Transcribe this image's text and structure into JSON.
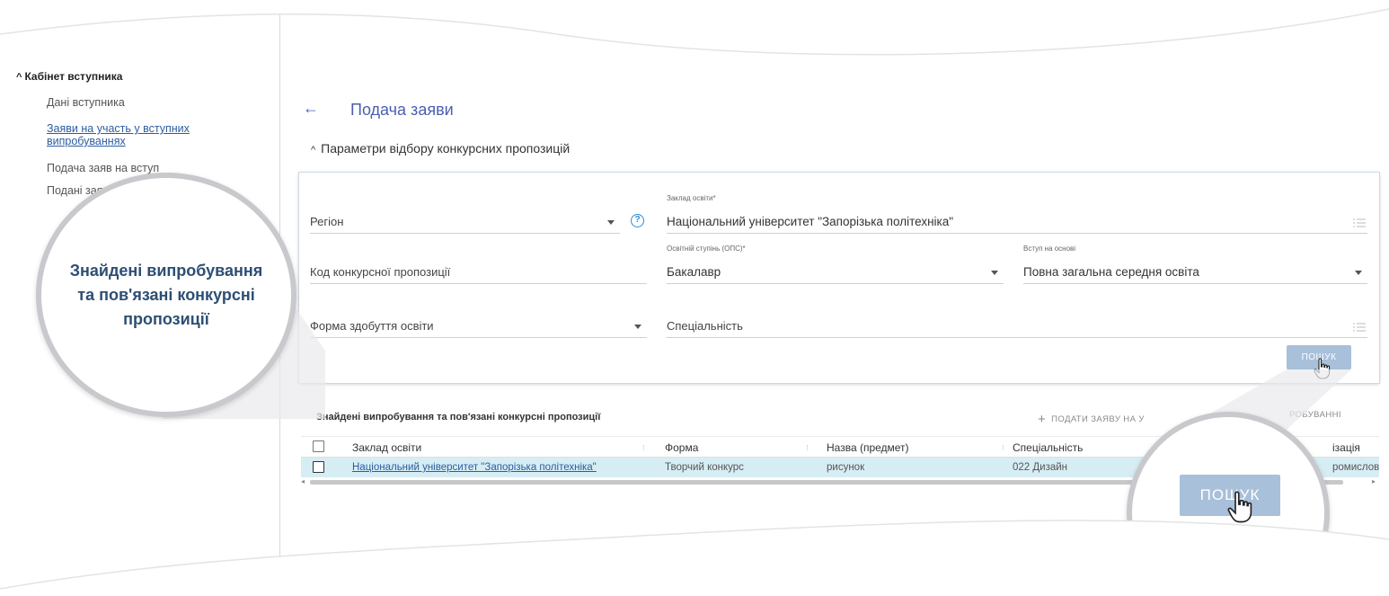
{
  "sidebar": {
    "heading": "Кабінет вступника",
    "items": [
      {
        "label": "Дані вступника"
      },
      {
        "label": "Заяви на участь у вступних випробуваннях",
        "line1": "Заяви на участь у вступних",
        "line2": "випробуваннях"
      },
      {
        "label": "Подача заяв на вступ"
      },
      {
        "label": "Подані зая"
      }
    ]
  },
  "page": {
    "title": "Подача заяви",
    "section_title": "Параметри відбору конкурсних пропозицій"
  },
  "filters": {
    "region": {
      "placeholder": "Регіон"
    },
    "institution": {
      "caption": "Заклад освіти*",
      "value": "Національний університет \"Запорізька політехніка\""
    },
    "offer_code": {
      "placeholder": "Код конкурсної пропозиції"
    },
    "degree": {
      "caption": "Освітній ступінь (ОПС)*",
      "value": "Бакалавр"
    },
    "basis": {
      "caption": "Вступ на основі",
      "value": "Повна загальна середня освіта"
    },
    "study_form": {
      "placeholder": "Форма здобуття освіти"
    },
    "specialty": {
      "placeholder": "Спеціальність"
    },
    "search_label": "ПОШУК"
  },
  "results": {
    "title": "Знайдені випробування та пов'язані конкурсні пропозиції",
    "apply_label": "ПОДАТИ ЗАЯВУ НА У",
    "apply_label_tail": "РОБУВАННІ",
    "columns": [
      "Заклад освіти",
      "Форма",
      "Назва (предмет)",
      "Спеціальність",
      "ізація"
    ],
    "rows": [
      {
        "institution": "Національний університет \"Запорізька політехніка\"",
        "form": "Творчий конкурс",
        "subject": "рисунок",
        "specialty": "022 Дизайн",
        "specialization": "ромислов"
      }
    ]
  },
  "callout": {
    "text_line1": "Знайдені випробування",
    "text_line2": "та пов'язані конкурсні",
    "text_line3": "пропозиції",
    "zoom_button_label": "ПОШУК"
  },
  "icons": {
    "back": "arrow-left-icon",
    "help": "help-circle-icon",
    "list": "list-icon",
    "dropdown": "caret-down-icon",
    "cursor": "hand-pointer-icon"
  },
  "colors": {
    "accent": "#4a5fb0",
    "link": "#2c5d9e",
    "button": "#a8c0d9",
    "row_highlight": "#d7edf4",
    "callout_text": "#2d4e74"
  }
}
